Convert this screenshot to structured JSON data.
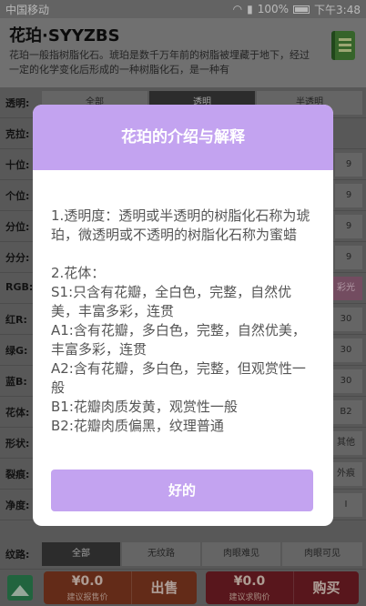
{
  "status": {
    "carrier": "中国移动",
    "battery": "100%",
    "time": "下午3:48"
  },
  "header": {
    "title": "花珀·SYYZBS",
    "desc": "花珀一般指树脂化石。琥珀是数千万年前的树脂被埋藏于地下，经过一定的化学变化后形成的一种树脂化石，是一种有"
  },
  "form": {
    "rows": [
      {
        "label": "透明:",
        "cells": [
          "全部",
          "透明",
          "半透明"
        ]
      },
      {
        "label": "克拉:",
        "cells": []
      },
      {
        "label": "十位:",
        "cells": [
          "9"
        ]
      },
      {
        "label": "个位:",
        "cells": [
          "9"
        ]
      },
      {
        "label": "分位:",
        "cells": [
          "9"
        ]
      },
      {
        "label": "分分:",
        "cells": [
          "9"
        ]
      },
      {
        "label": "RGB:",
        "cells": [
          "彩光"
        ]
      },
      {
        "label": "红R:",
        "cells": [
          "30"
        ]
      },
      {
        "label": "绿G:",
        "cells": [
          "30"
        ]
      },
      {
        "label": "蓝B:",
        "cells": [
          "30"
        ]
      },
      {
        "label": "花体:",
        "cells": [
          "B2"
        ]
      },
      {
        "label": "形状:",
        "cells": [
          "其他"
        ]
      },
      {
        "label": "裂痕:",
        "cells": [
          "外痕"
        ]
      },
      {
        "label": "净度:",
        "cells": [
          "I"
        ]
      },
      {
        "label": "纹路:",
        "cells": [
          "全部",
          "无纹路",
          "肉眼难见",
          "肉眼可见"
        ]
      }
    ]
  },
  "bottom": {
    "sell_price": "¥0.0",
    "sell_sub": "建议报售价",
    "sell_label": "出售",
    "buy_price": "¥0.0",
    "buy_sub": "建议求购价",
    "buy_label": "购买"
  },
  "dialog": {
    "title": "花珀的介绍与解释",
    "lines": [
      "1.透明度：透明或半透明的树脂化石称为琥珀，微透明或不透明的树脂化石称为蜜蜡",
      "2.花体：",
      "S1:只含有花瓣，全白色，完整，自然优美，丰富多彩，连贯",
      "A1:含有花瓣，多白色，完整，自然优美，丰富多彩，连贯",
      "A2:含有花瓣，多白色，完整，但观赏性一般",
      "B1:花瓣肉质发黄，观赏性一般",
      "B2:花瓣肉质偏黑，纹理普通"
    ],
    "ok_label": "好的"
  },
  "colors": {
    "accent": "#c3a3f0",
    "header_bg": "#9b9b9b",
    "sell_bg": "#8a3c22",
    "buy_bg": "#7a1f27"
  }
}
